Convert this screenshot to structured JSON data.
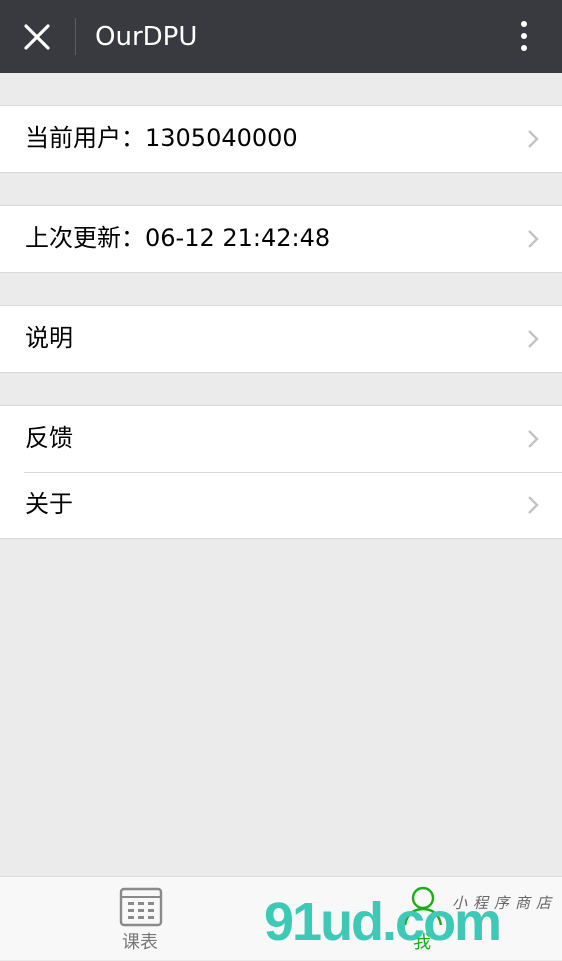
{
  "app": {
    "title": "OurDPU"
  },
  "header": {
    "close_icon": "close-icon",
    "more_icon": "more-vertical-icon"
  },
  "groups": [
    {
      "items": [
        {
          "label": "当前用户：1305040000"
        }
      ]
    },
    {
      "items": [
        {
          "label": "上次更新：06-12 21:42:48"
        }
      ]
    },
    {
      "items": [
        {
          "label": "说明"
        }
      ]
    },
    {
      "items": [
        {
          "label": "反馈"
        },
        {
          "label": "关于"
        }
      ]
    }
  ],
  "tabbar": {
    "tabs": [
      {
        "label": "课表",
        "icon": "timetable-icon",
        "active": false
      },
      {
        "label": "我",
        "icon": "person-icon",
        "active": true
      }
    ]
  },
  "watermark": {
    "logo": "91ud.com",
    "subtitle": "小程序商店"
  },
  "colors": {
    "topbar": "#393a3f",
    "background": "#ebebeb",
    "active_tab": "#1aad19",
    "watermark": "#3ec8b6"
  }
}
